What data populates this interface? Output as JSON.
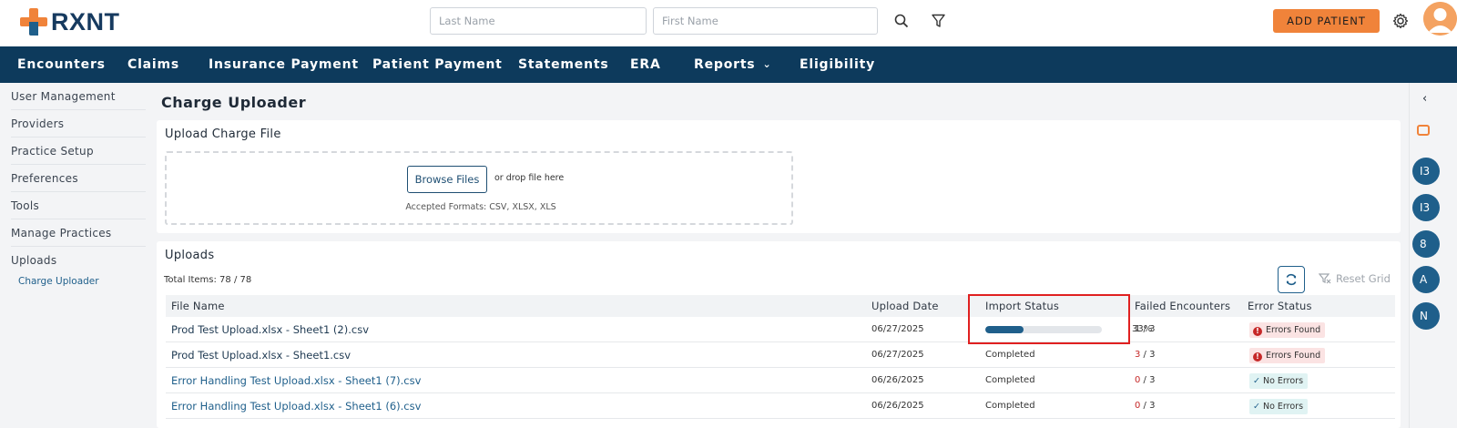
{
  "brand": {
    "name": "RXNT",
    "accent": "#f0833a",
    "primary": "#0d3a5c"
  },
  "search": {
    "last_name_placeholder": "Last Name",
    "first_name_placeholder": "First Name",
    "search_icon": "search-icon",
    "filter_icon": "filter-icon"
  },
  "header": {
    "add_patient_label": "ADD PATIENT",
    "settings_icon": "gear-icon"
  },
  "nav": {
    "items": [
      "Encounters",
      "Claims",
      "Insurance Payment",
      "Patient Payment",
      "Statements",
      "ERA",
      "Reports",
      "Eligibility"
    ]
  },
  "sidebar": {
    "items": [
      "User Management",
      "Providers",
      "Practice Setup",
      "Preferences",
      "Tools",
      "Manage Practices",
      "Uploads"
    ],
    "sub_item": "Charge Uploader"
  },
  "page": {
    "title": "Charge Uploader"
  },
  "upload_card": {
    "title": "Upload Charge File",
    "browse_label": "Browse Files",
    "drop_text": "or drop file here",
    "formats": "Accepted Formats: CSV, XLSX, XLS"
  },
  "uploads": {
    "title": "Uploads",
    "total_items": "Total Items: 78 / 78",
    "reset_grid": "Reset Grid",
    "columns": [
      "File Name",
      "Upload Date",
      "Import Status",
      "Failed Encounters",
      "Error Status"
    ],
    "rows": [
      {
        "file": "Prod Test Upload.xlsx - Sheet1 (2).csv",
        "date": "06/27/2025",
        "status": "",
        "progress": 0.33,
        "progress_label": "33%",
        "failed": "1",
        "failed_total": " / 3",
        "error_status": "Errors Found",
        "error_type": "err"
      },
      {
        "file": "Prod Test Upload.xlsx - Sheet1.csv",
        "date": "06/27/2025",
        "status": "Completed",
        "failed": "3",
        "failed_total": " / 3",
        "error_status": "Errors Found",
        "error_type": "err"
      },
      {
        "file": "Error Handling Test Upload.xlsx - Sheet1 (7).csv",
        "date": "06/26/2025",
        "status": "Completed",
        "failed": "0",
        "failed_total": " / 3",
        "error_status": "No Errors",
        "error_type": "ok"
      },
      {
        "file": "Error Handling Test Upload.xlsx - Sheet1 (6).csv",
        "date": "06/26/2025",
        "status": "Completed",
        "failed": "0",
        "failed_total": " / 3",
        "error_status": "No Errors",
        "error_type": "ok"
      }
    ]
  },
  "right_rail": {
    "circles": [
      "I3",
      "I3",
      "8",
      "A",
      "N"
    ]
  }
}
